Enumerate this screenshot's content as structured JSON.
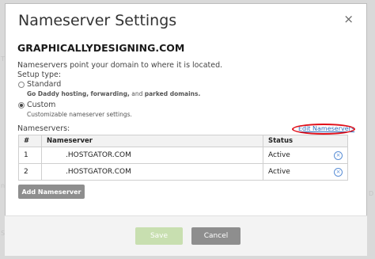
{
  "backdrop": {
    "fragment_1": "Ti",
    "fragment_2": "n.",
    "fragment_3": "SI",
    "fragment_4": "D"
  },
  "dialog": {
    "title": "Nameserver Settings",
    "close_glyph": "×",
    "domain": "GRAPHICALLYDESIGNING.COM",
    "description": "Nameservers point your domain to where it is located.",
    "setup_type_label": "Setup type:",
    "option_standard": {
      "label": "Standard",
      "desc_part1": "Go Daddy hosting,",
      "desc_part2": "forwarding,",
      "desc_part3": "and",
      "desc_part4": "parked domains.",
      "checked": false
    },
    "option_custom": {
      "label": "Custom",
      "desc": "Customizable nameserver settings.",
      "checked": true
    },
    "nameservers_label": "Nameservers:",
    "edit_link": "Edit Nameservers",
    "highlight_color": "#e0101a",
    "table": {
      "headers": [
        "#",
        "Nameserver",
        "Status"
      ],
      "rows": [
        {
          "num": "1",
          "nameserver": ".HOSTGATOR.COM",
          "status": "Active"
        },
        {
          "num": "2",
          "nameserver": ".HOSTGATOR.COM",
          "status": "Active"
        }
      ],
      "remove_icon": "remove-circle-icon"
    },
    "add_button": "Add Nameserver",
    "footer": {
      "save": "Save",
      "cancel": "Cancel"
    }
  }
}
